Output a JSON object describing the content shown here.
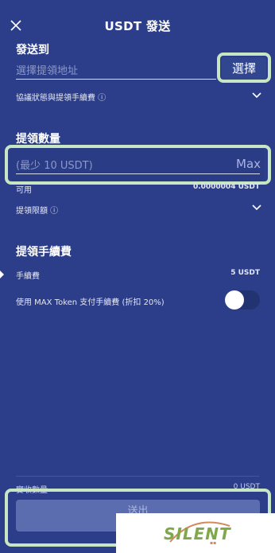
{
  "header": {
    "title": "USDT 發送"
  },
  "send_to": {
    "label": "發送到",
    "address_placeholder": "選擇提領地址",
    "select_button": "選擇",
    "protocol_row": "協議狀態與提領手續費 ⓘ"
  },
  "amount": {
    "label": "提領數量",
    "placeholder": "(最少 10 USDT)",
    "max_button": "Max",
    "available_label": "可用",
    "available_value": "0.0000004 USDT",
    "limit_row": "提領限額 ⓘ"
  },
  "fee": {
    "label": "提領手續費",
    "fee_label": "手續費",
    "fee_value": "5 USDT",
    "max_token_label": "使用 MAX Token 支付手續費 (折扣 20%)",
    "max_token_enabled": false
  },
  "footer": {
    "received_label": "實收數量",
    "received_value": "0 USDT",
    "submit_button": "送出"
  },
  "watermark": {
    "brand": "SILENT"
  },
  "colors": {
    "background": "#2c3e8a",
    "highlight_frame": "#c8e6c2",
    "muted_text": "#8c98c8"
  }
}
